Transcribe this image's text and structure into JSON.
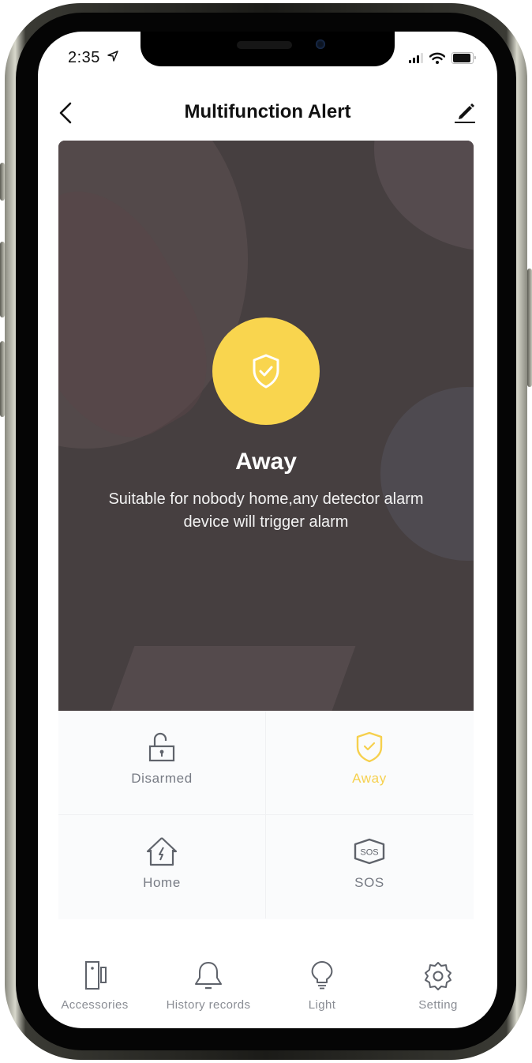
{
  "status_bar": {
    "time": "2:35",
    "location_icon": "location-arrow-icon",
    "signal_icon": "cellular-signal-icon",
    "wifi_icon": "wifi-icon",
    "battery_icon": "battery-icon"
  },
  "nav": {
    "back_icon": "chevron-left-icon",
    "title": "Multifunction Alert",
    "edit_icon": "pencil-icon"
  },
  "hero": {
    "mode_icon": "shield-check-icon",
    "mode_title": "Away",
    "mode_description": "Suitable for nobody home,any detector alarm device will trigger alarm"
  },
  "modes": [
    {
      "label": "Disarmed",
      "icon": "unlocked-padlock-icon",
      "active": false
    },
    {
      "label": "Away",
      "icon": "shield-check-icon",
      "active": true
    },
    {
      "label": "Home",
      "icon": "house-bolt-icon",
      "active": false
    },
    {
      "label": "SOS",
      "icon": "sos-hexagon-icon",
      "active": false
    }
  ],
  "tab_bar": [
    {
      "label": "Accessories",
      "icon": "door-sensor-icon"
    },
    {
      "label": "History records",
      "icon": "bell-icon"
    },
    {
      "label": "Light",
      "icon": "lightbulb-icon"
    },
    {
      "label": "Setting",
      "icon": "gear-icon"
    }
  ],
  "colors": {
    "accent": "#f9d54e",
    "active_label": "#f6d04d",
    "icon_gray": "#5f636b",
    "label_gray": "#777b84",
    "hero_bg": "#463f40"
  }
}
